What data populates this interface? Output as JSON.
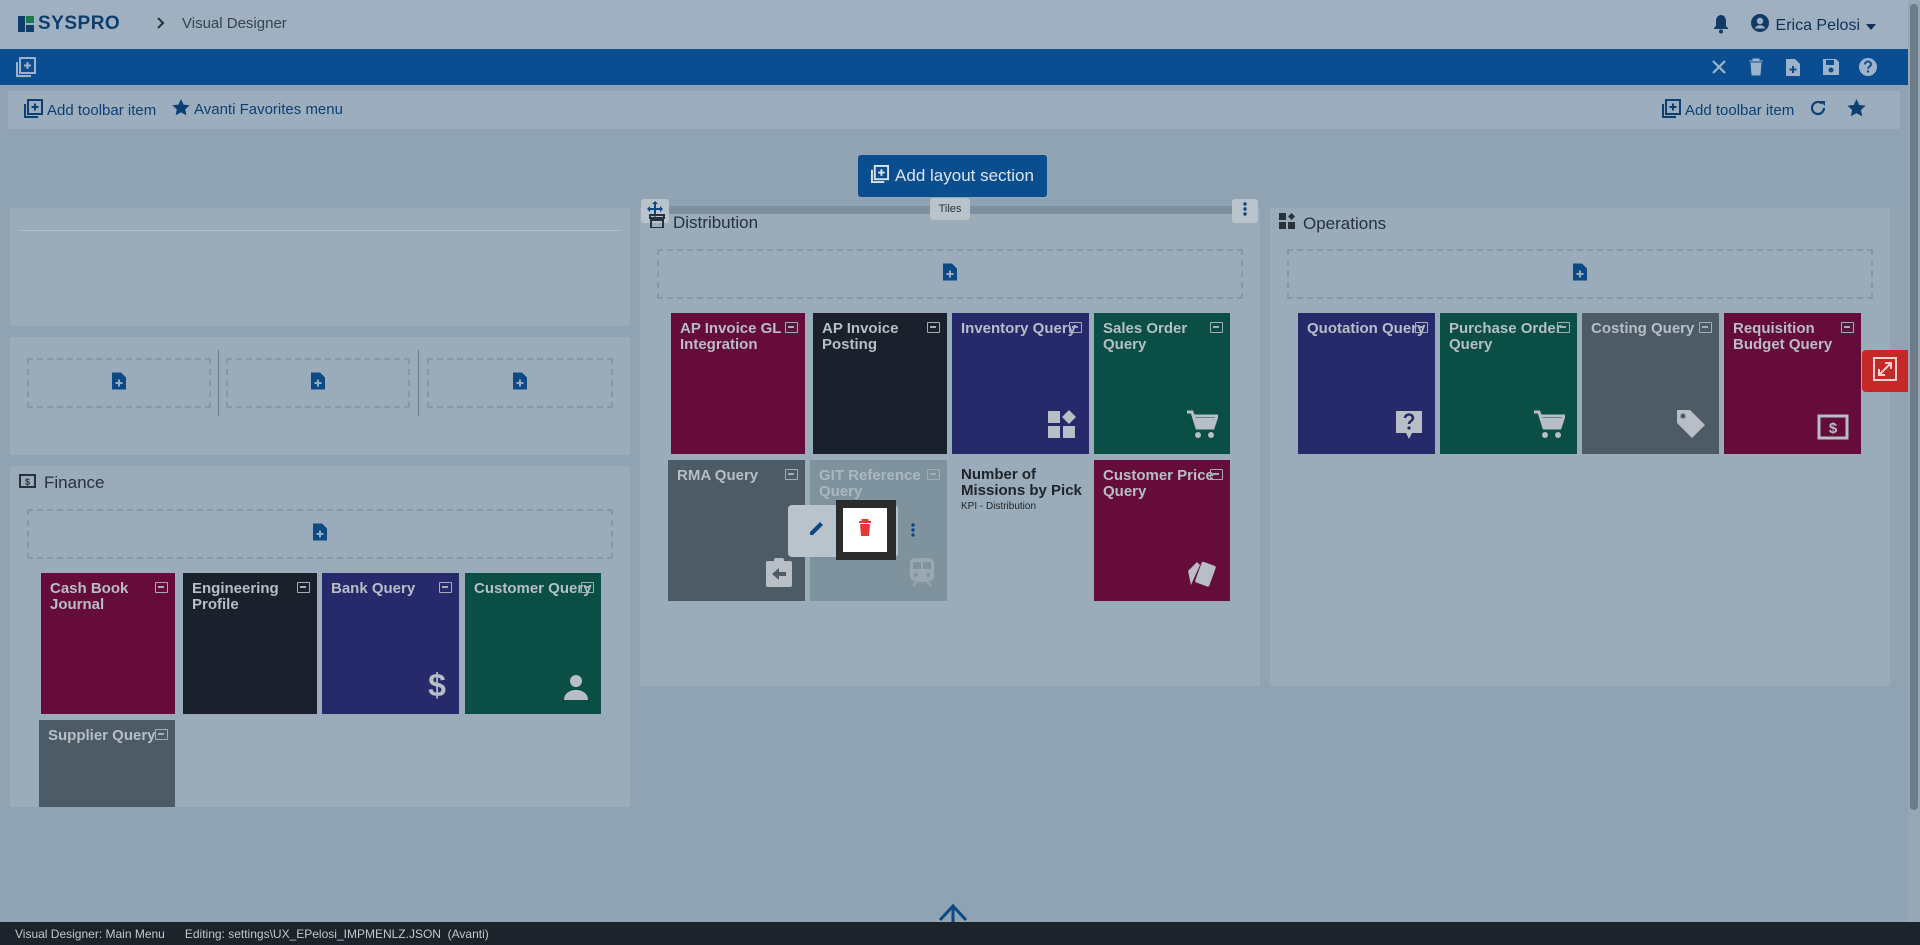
{
  "header": {
    "brand": "SYSPRO",
    "breadcrumb": "Visual Designer",
    "user_name": "Erica Pelosi"
  },
  "toolbar": {
    "left_add": "Add toolbar item",
    "left_favorites": "Avanti Favorites menu",
    "right_add": "Add toolbar item"
  },
  "layout": {
    "add_section": "Add layout section",
    "tiles_tab": "Tiles"
  },
  "finance": {
    "title": "Finance",
    "tiles": [
      {
        "label": "Cash Book Journal",
        "icon": "none"
      },
      {
        "label": "Engineering Profile",
        "icon": "none"
      },
      {
        "label": "Bank Query",
        "icon": "dollar-icon"
      },
      {
        "label": "Customer Query",
        "icon": "person-icon"
      },
      {
        "label": "Supplier Query",
        "icon": "none"
      }
    ]
  },
  "distribution": {
    "title": "Distribution",
    "tiles": [
      {
        "label": "AP Invoice GL Integration",
        "icon": "none"
      },
      {
        "label": "AP Invoice Posting",
        "icon": "none"
      },
      {
        "label": "Inventory Query",
        "icon": "widgets-icon"
      },
      {
        "label": "Sales Order Query",
        "icon": "cart-icon"
      },
      {
        "label": "RMA Query",
        "icon": "return-clipboard-icon"
      },
      {
        "label": "GIT Reference Query",
        "icon": "train-icon"
      },
      {
        "label": "Customer Price Query",
        "icon": "price-cards-icon"
      }
    ],
    "kpi": {
      "title": "Number of Missions by Pick",
      "subtitle": "KPI - Distribution"
    }
  },
  "operations": {
    "title": "Operations",
    "tiles": [
      {
        "label": "Quotation Query",
        "icon": "question-bubble-icon"
      },
      {
        "label": "Purchase Order Query",
        "icon": "cart-icon"
      },
      {
        "label": "Costing Query",
        "icon": "tag-icon"
      },
      {
        "label": "Requisition Budget Query",
        "icon": "money-icon"
      }
    ]
  },
  "status": {
    "left": "Visual Designer: Main Menu",
    "right": "Editing: settings\\UX_EPelosi_IMPMENLZ.JSON  (Avanti)"
  },
  "colors": {
    "primary": "#0b4e8f",
    "pink": "#660c3b",
    "dark": "#1b212c",
    "navy": "#262a6b",
    "green": "#0a4e46",
    "grey": "#4c5b66",
    "delete": "#e53935",
    "collapse": "#c62828"
  }
}
